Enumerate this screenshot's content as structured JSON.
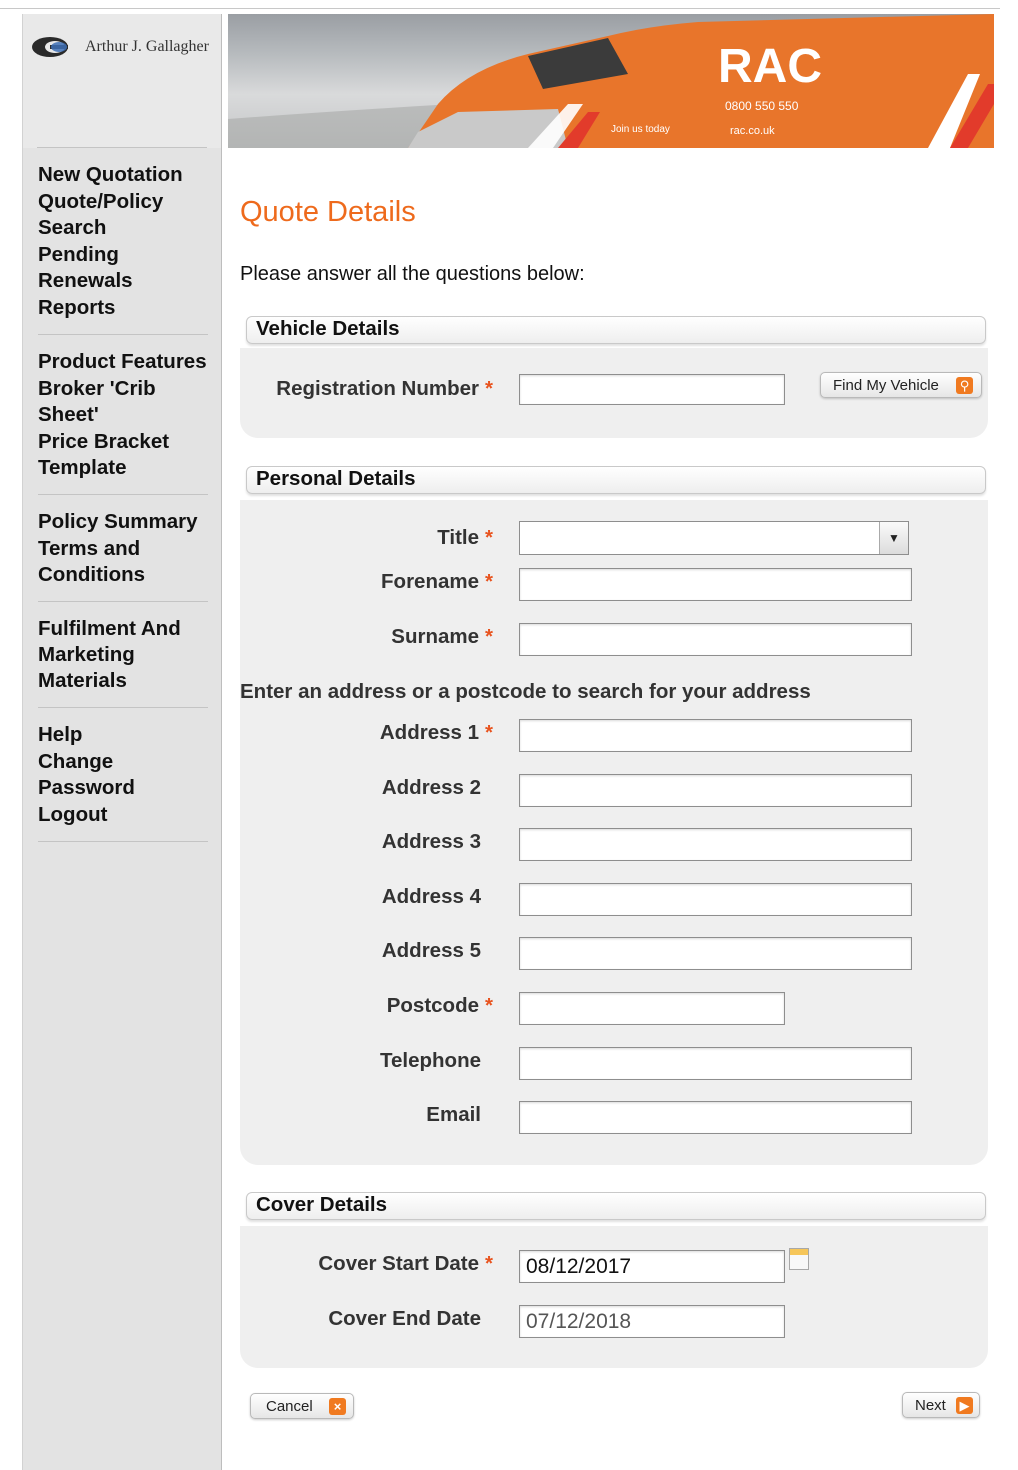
{
  "logo": {
    "company": "Arthur J. Gallagher"
  },
  "banner": {
    "brand": "RAC",
    "phone": "0800 550 550",
    "join": "Join us today",
    "site": "rac.co.uk"
  },
  "nav": {
    "groups": [
      [
        "New Quotation",
        "Quote/Policy Search",
        "Pending Renewals",
        "Reports"
      ],
      [
        "Product Features",
        "Broker 'Crib Sheet'",
        "Price Bracket Template"
      ],
      [
        "Policy Summary",
        "Terms and Conditions"
      ],
      [
        "Fulfilment And Marketing Materials"
      ],
      [
        "Help",
        "Change Password",
        "Logout"
      ]
    ]
  },
  "page": {
    "title": "Quote Details",
    "instructions": "Please answer all the questions below:"
  },
  "vehicle": {
    "header": "Vehicle Details",
    "reg_label": "Registration Number",
    "reg_value": "",
    "find_button": "Find My Vehicle"
  },
  "personal": {
    "header": "Personal Details",
    "title_label": "Title",
    "title_value": "",
    "forename_label": "Forename",
    "surname_label": "Surname",
    "address_hint": "Enter an address or a postcode to search for your address",
    "address1_label": "Address 1",
    "address2_label": "Address 2",
    "address3_label": "Address 3",
    "address4_label": "Address 4",
    "address5_label": "Address 5",
    "postcode_label": "Postcode",
    "telephone_label": "Telephone",
    "email_label": "Email"
  },
  "cover": {
    "header": "Cover Details",
    "start_label": "Cover Start Date",
    "start_value": "08/12/2017",
    "end_label": "Cover End Date",
    "end_value": "07/12/2018"
  },
  "actions": {
    "cancel": "Cancel",
    "next": "Next"
  },
  "required_marker": "*",
  "colors": {
    "accent": "#ee6a1c",
    "required": "#e8531e",
    "sidebar": "#e3e3e3",
    "panel": "#efefef"
  }
}
